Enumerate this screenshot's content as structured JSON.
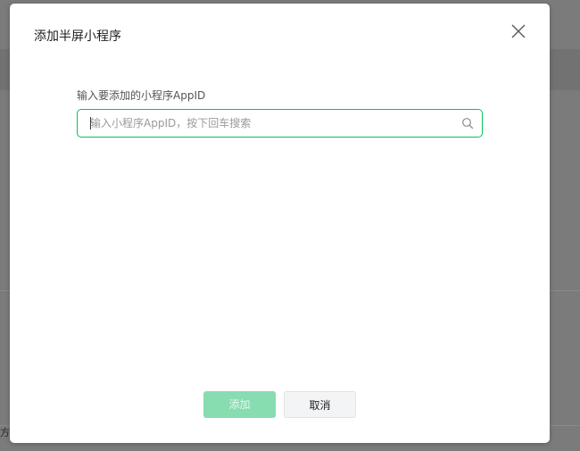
{
  "background": {
    "fragment_text": "方("
  },
  "dialog": {
    "title": "添加半屏小程序",
    "close_icon": "close-icon",
    "field_label": "输入要添加的小程序AppID",
    "search": {
      "placeholder": "输入小程序AppID，按下回车搜索",
      "value": "",
      "icon": "search-icon"
    },
    "buttons": {
      "add_label": "添加",
      "cancel_label": "取消"
    }
  },
  "colors": {
    "accent": "#07c160",
    "add_button_disabled": "#87dcb0",
    "overlay": "#7b7b7b"
  }
}
